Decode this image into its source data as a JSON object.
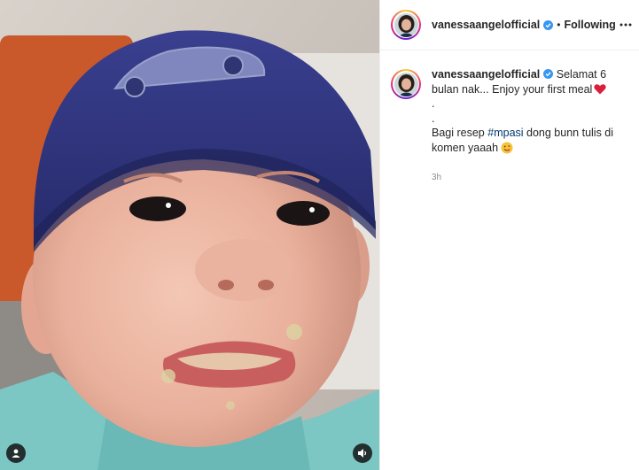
{
  "post": {
    "author": "vanessaangelofficial",
    "follow_separator": "•",
    "follow_status": "Following",
    "more_icon": "more-options-icon",
    "verified_color": "#3897f0",
    "ring_colors": [
      "#f9ce34",
      "#ee2a7b",
      "#6228d7"
    ]
  },
  "caption": {
    "author": "vanessaangelofficial",
    "line1": "Selamat 6 bulan nak... Enjoy your first meal",
    "dot1": ".",
    "dot2": ".",
    "line3_pre": "Bagi resep",
    "hashtag": "#mpasi",
    "line3_post": "dong bunn tulis di komen yaaah",
    "timestamp": "3h"
  },
  "media": {
    "tag_icon": "user-tag-icon",
    "mute_icon": "speaker-icon"
  }
}
